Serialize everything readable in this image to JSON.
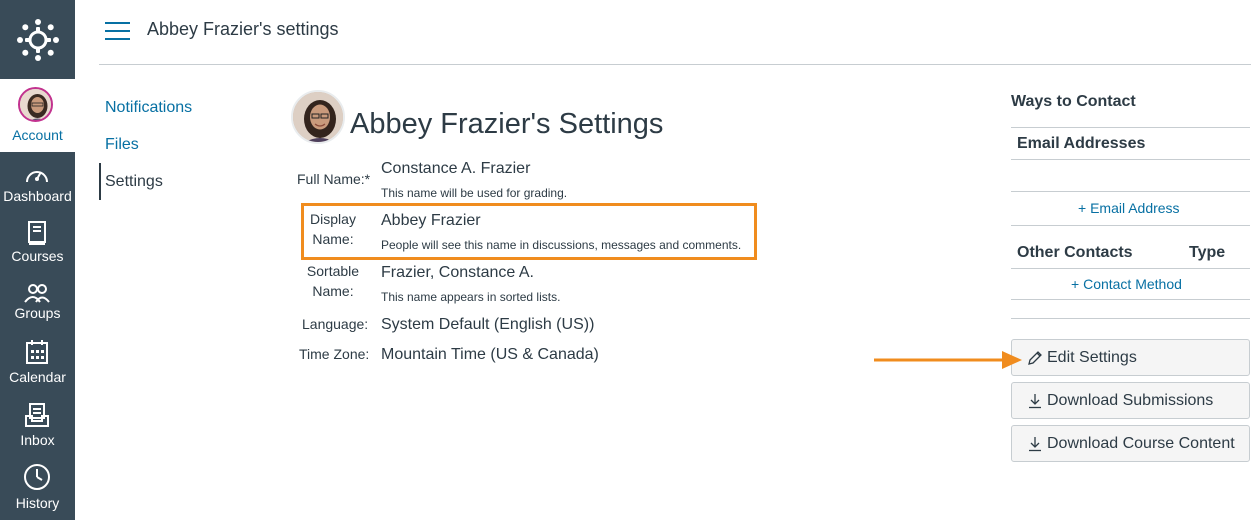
{
  "header": {
    "breadcrumb": "Abbey Frazier's settings"
  },
  "global_nav": {
    "account": "Account",
    "items": [
      {
        "label": "Dashboard",
        "icon": "dashboard-icon"
      },
      {
        "label": "Courses",
        "icon": "courses-icon"
      },
      {
        "label": "Groups",
        "icon": "groups-icon"
      },
      {
        "label": "Calendar",
        "icon": "calendar-icon"
      },
      {
        "label": "Inbox",
        "icon": "inbox-icon"
      },
      {
        "label": "History",
        "icon": "history-icon"
      }
    ]
  },
  "sub_nav": {
    "notifications": "Notifications",
    "files": "Files",
    "settings": "Settings"
  },
  "main": {
    "title": "Abbey Frazier's Settings",
    "fields": {
      "full_name_label": "Full Name:*",
      "full_name": "Constance A. Frazier",
      "full_name_hint": "This name will be used for grading.",
      "display_label_1": "Display",
      "display_label_2": "Name:",
      "display_name": "Abbey Frazier",
      "display_hint": "People will see this name in discussions, messages and comments.",
      "sortable_label_1": "Sortable",
      "sortable_label_2": "Name:",
      "sortable_name": "Frazier, Constance A.",
      "sortable_hint": "This name appears in sorted lists.",
      "language_label": "Language:",
      "language": "System Default (English (US))",
      "timezone_label": "Time Zone:",
      "timezone": "Mountain Time (US & Canada)"
    }
  },
  "sidebar": {
    "ways_to_contact": "Ways to Contact",
    "email_addresses": "Email Addresses",
    "add_email": "Email Address",
    "other_contacts": "Other Contacts",
    "type": "Type",
    "add_contact": "Contact Method",
    "edit_settings": "Edit Settings",
    "download_submissions": "Download Submissions",
    "download_course_content": "Download Course Content"
  },
  "colors": {
    "nav_bg": "#394b58",
    "link": "#0770a3",
    "highlight": "#f08c1e"
  }
}
